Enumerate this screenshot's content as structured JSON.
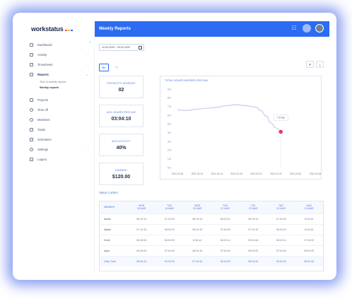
{
  "app": {
    "logo_text": "workstatus",
    "logo_colors": [
      "#f04d4d",
      "#f6b92a",
      "#2b6cf3"
    ],
    "page_title": "Weekly Reports",
    "accent_color": "#2b6cf3"
  },
  "topbar": {
    "icons": [
      "network-icon",
      "user-avatar-icon",
      "profile-photo"
    ]
  },
  "sidebar": {
    "collapse_icon": "double-chevron-left-icon",
    "items": [
      {
        "label": "Dashboard",
        "icon": "dashboard-icon",
        "chevron": false
      },
      {
        "label": "Activity",
        "icon": "activity-icon",
        "chevron": true
      },
      {
        "label": "Timesheets",
        "icon": "timesheet-icon",
        "chevron": true
      },
      {
        "label": "Reports",
        "icon": "reports-icon",
        "chevron": true
      },
      {
        "label": "Projects",
        "icon": "projects-icon",
        "chevron": false
      },
      {
        "label": "Time off",
        "icon": "clock-icon",
        "chevron": false
      },
      {
        "label": "Members",
        "icon": "members-icon",
        "chevron": false
      },
      {
        "label": "Todos",
        "icon": "todos-icon",
        "chevron": false
      },
      {
        "label": "Schedules",
        "icon": "calendar-icon",
        "chevron": false
      },
      {
        "label": "Settings",
        "icon": "gear-icon",
        "chevron": true
      },
      {
        "label": "Logout",
        "icon": "logout-icon",
        "chevron": false
      }
    ],
    "report_subitems": [
      "Time & activity reports",
      "Weekly reports"
    ]
  },
  "filters": {
    "date_range": "10-02-2020 - 09-02-2020",
    "calendar_icon": "calendar-icon"
  },
  "tabs": [
    {
      "label": "Me",
      "active": true
    },
    {
      "label": "All",
      "active": false
    }
  ],
  "toolbar": {
    "filter_icon": "filter-icon",
    "download_icon": "download-icon"
  },
  "stats": [
    {
      "label": "PROJECTS WORKED",
      "value": "02"
    },
    {
      "label": "AVG HOURS PER DAY",
      "value": "03:04:10"
    },
    {
      "label": "AVG ACTIVITY",
      "value": "40%"
    },
    {
      "label": "EARNED",
      "value": "$120.00"
    }
  ],
  "chart_data": {
    "type": "line",
    "title": "TOTAL HOURS WORKED PER DAY",
    "x": [
      "2021-02-06",
      "2021-02-10",
      "2021-02-14",
      "2021-02-18",
      "2021-02-22",
      "2021-02-26",
      "2021-03-02",
      "2021-03-06"
    ],
    "x_ticks": [
      "2021-02-06",
      "2021-02-10",
      "2021-02-14",
      "2021-02-18",
      "2021-02-22",
      "2021-02-26",
      "2021-03-02",
      "2021-03-06"
    ],
    "ylim": [
      0,
      9
    ],
    "y_ticks": [
      0,
      1,
      2,
      3,
      4,
      5,
      6,
      7,
      8,
      9
    ],
    "y_tick_labels": [
      "0.0",
      "1.0",
      "2.0",
      "3.0",
      "4.0",
      "5.0",
      "6.0",
      "7.0",
      "8.0",
      "9.0"
    ],
    "series": [
      {
        "color": "#c9c2f0",
        "values": [
          6.6,
          6.55,
          6.7,
          6.8,
          6.9,
          7.1,
          7.2,
          7.1,
          7.0,
          6.9,
          6.5,
          5.9,
          5.1,
          4.55,
          4.1
        ],
        "x": [
          "2021-02-06",
          "2021-02-08",
          "2021-02-10",
          "2021-02-12",
          "2021-02-14",
          "2021-02-16",
          "2021-02-18",
          "2021-02-20",
          "2021-02-21",
          "2021-02-22",
          "2021-02-23",
          "2021-02-24",
          "2021-02-25",
          "2021-02-26",
          "2021-02-27"
        ]
      }
    ],
    "highlight": {
      "x": "2021-02-27",
      "y": 4.1,
      "label": "7.5 hrs"
    },
    "grid": false
  },
  "value_section_title": "Value Coders",
  "table": {
    "headers": [
      {
        "line1": "MEMBER",
        "line2": ""
      },
      {
        "line1": "MON",
        "line2": "18 MAR"
      },
      {
        "line1": "TUE",
        "line2": "19 MAR"
      },
      {
        "line1": "WED",
        "line2": "20 MAR"
      },
      {
        "line1": "THU",
        "line2": "21 MAR"
      },
      {
        "line1": "FRI",
        "line2": "22 MAR"
      },
      {
        "line1": "SAT",
        "line2": "23 MAR"
      },
      {
        "line1": "SUN",
        "line2": "24 MAR"
      }
    ],
    "rows": [
      [
        "Manik",
        "06:19:14",
        "07:15:34",
        "06:19:14",
        "06:19:14",
        "06:19:14",
        "07:30:00",
        "8:34:44"
      ],
      [
        "Nilakh",
        "07:14:15",
        "08:34:15",
        "06:34:15",
        "07:04:00",
        "07:14:15",
        "06:34:15",
        "8:34:44"
      ],
      [
        "Vivek",
        "08:30:00",
        "08:30:00",
        "8:34:44",
        "06:19:14",
        "09:34:44",
        "08:19:14",
        "07:30:00"
      ],
      [
        "Arjun",
        "06:04:00",
        "07:04:00",
        "06:34:15",
        "07:04:00",
        "08:00:00",
        "07:04:00",
        "06:04:00"
      ]
    ],
    "total": [
      "Daily Total",
      "08:34:44",
      "09:34:44",
      "07:34:44",
      "06:34:44",
      "08:34:44",
      "08:34:44",
      "06:34:44"
    ]
  }
}
